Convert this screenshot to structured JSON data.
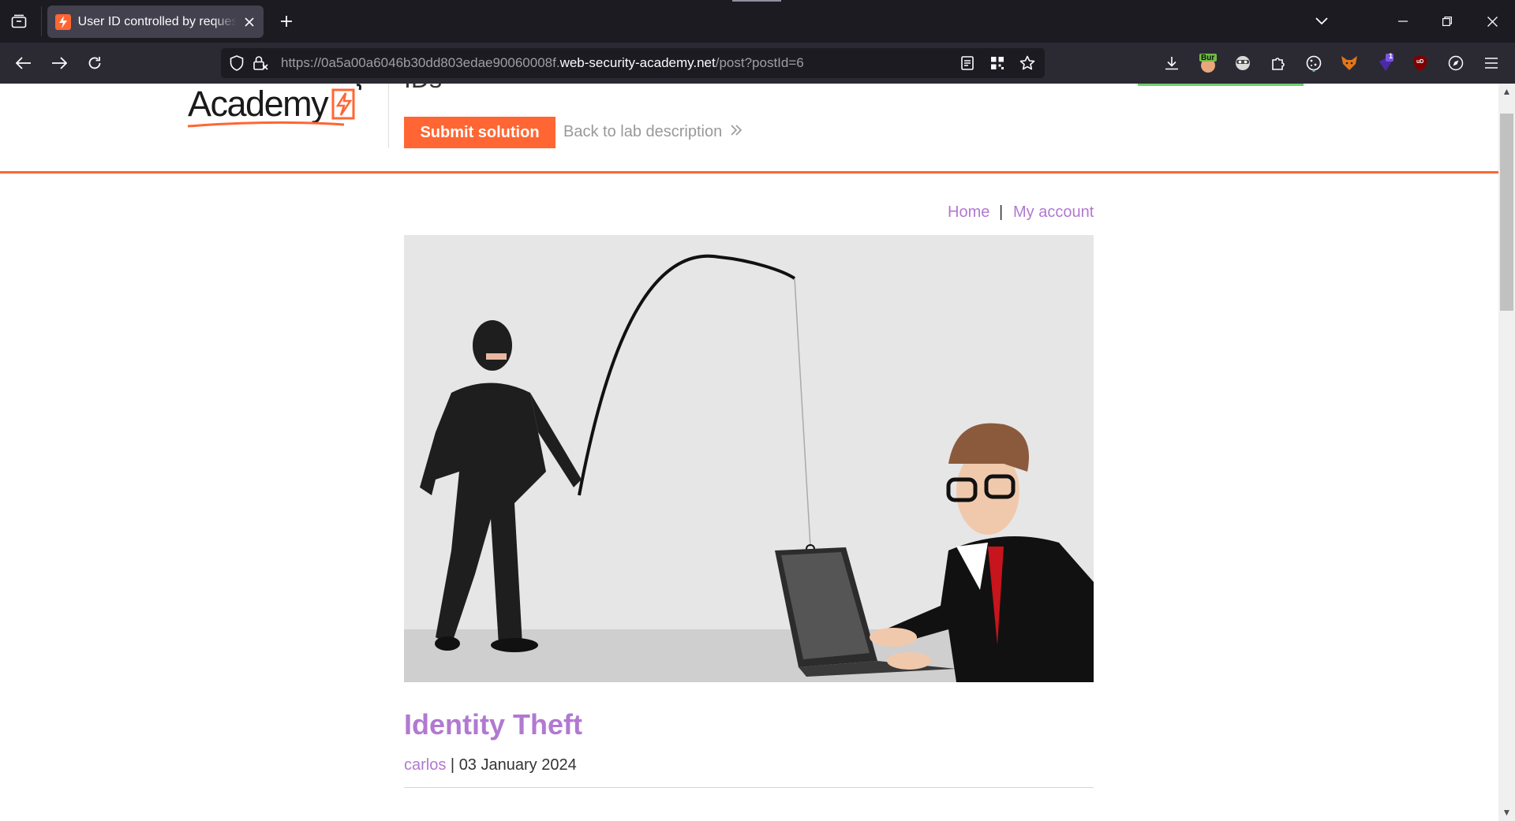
{
  "browser": {
    "tab": {
      "title": "User ID controlled by request parameter with unpredictable user IDs"
    },
    "url": {
      "prefix": "https://0a5a00a6046b30dd803edae90060008f.",
      "host": "web-security-academy.net",
      "path": "/post?postId=6"
    },
    "icons": [
      "tabs-list-icon",
      "lightning-icon",
      "close-icon",
      "plus-icon",
      "chevron-down-icon",
      "minimize-icon",
      "restore-icon",
      "window-close-icon",
      "back-arrow-icon",
      "forward-arrow-icon",
      "reload-icon",
      "shield-icon",
      "lock-icon",
      "reader-view-icon",
      "qr-code-icon",
      "star-icon",
      "download-icon",
      "burp-extension-icon",
      "mask-extension-icon",
      "puzzle-icon",
      "cookie-icon",
      "fox-icon",
      "notification-icon",
      "ublock-icon",
      "compass-icon",
      "hamburger-icon"
    ],
    "extensions": {
      "burp_label": "Bur",
      "notification_badge": "1",
      "ublock_label": "uD"
    }
  },
  "lab": {
    "logo_text": "Academy",
    "title_fragment": "IDs",
    "submit_label": "Submit solution",
    "back_label": "Back to lab description",
    "status_color": "#70d16d",
    "accent_color": "#ff6633"
  },
  "nav": {
    "home": "Home",
    "separator": "|",
    "account": "My account"
  },
  "post": {
    "title": "Identity Theft",
    "author": "carlos",
    "meta_separator": "|",
    "date": "03 January 2024",
    "image_alt": "Phishing illustration: burglar with fishing rod hooking a laptop used by businessman"
  },
  "colors": {
    "link": "#b179d1",
    "chrome_dark": "#1c1b22",
    "chrome": "#2b2a33"
  }
}
